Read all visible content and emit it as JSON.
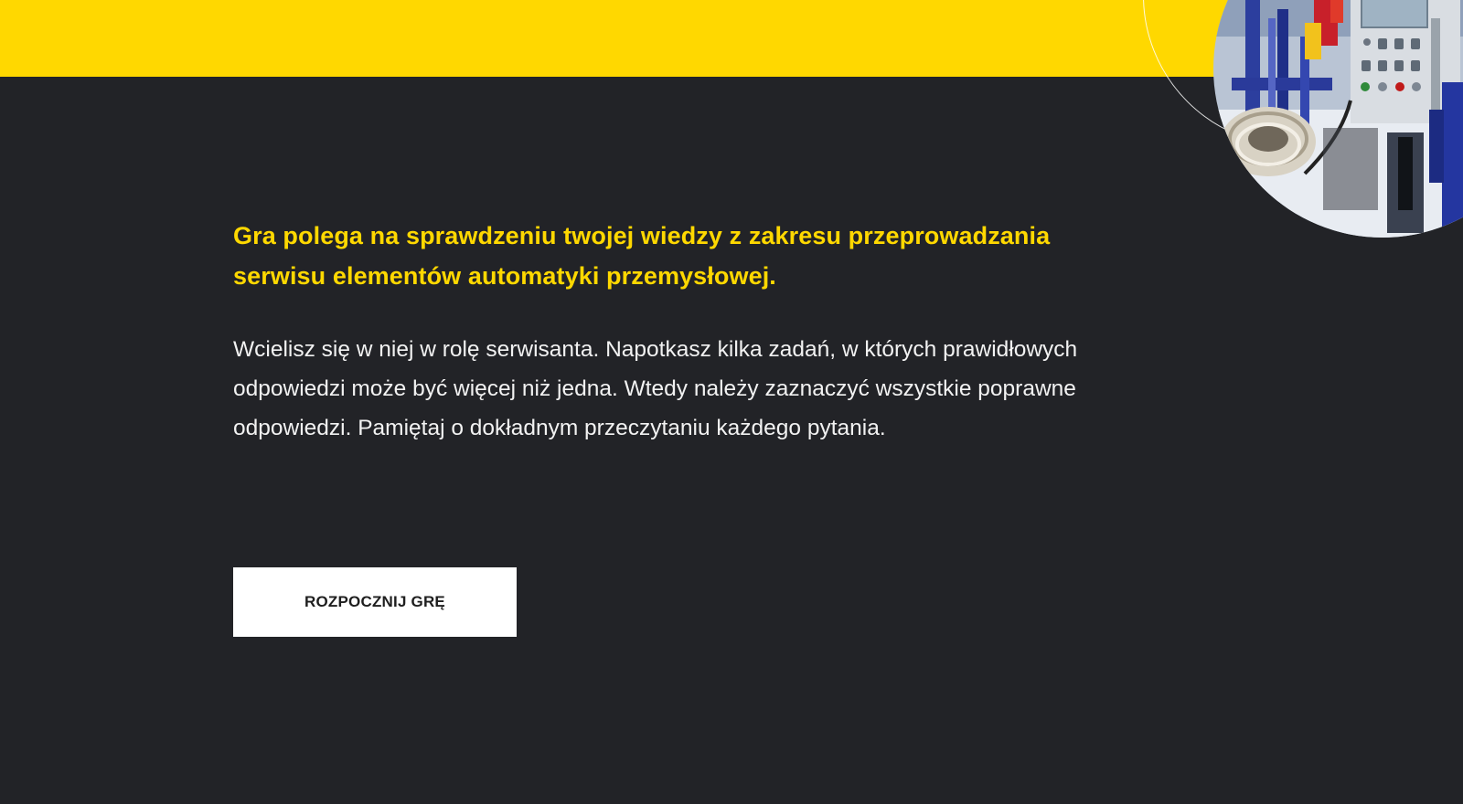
{
  "intro": {
    "lead": "Gra polega na sprawdzeniu twojej wiedzy z zakresu przeprowadzania serwisu elementów automatyki przemysłowej.",
    "body": "Wcielisz się w niej w rolę serwisanta. Napotkasz kilka zadań, w których prawidłowych odpowiedzi może być więcej niż jedna. Wtedy należy zaznaczyć wszystkie poprawne odpowiedzi. Pamiętaj o dokładnym przeczytaniu każdego pytania."
  },
  "actions": {
    "start_label": "ROZPOCZNIJ GRĘ"
  },
  "colors": {
    "accent_yellow": "#ffd800",
    "background_dark": "#222327",
    "button_bg": "#ffffff"
  },
  "hero_image": {
    "icon": "industrial-machine-photo"
  }
}
